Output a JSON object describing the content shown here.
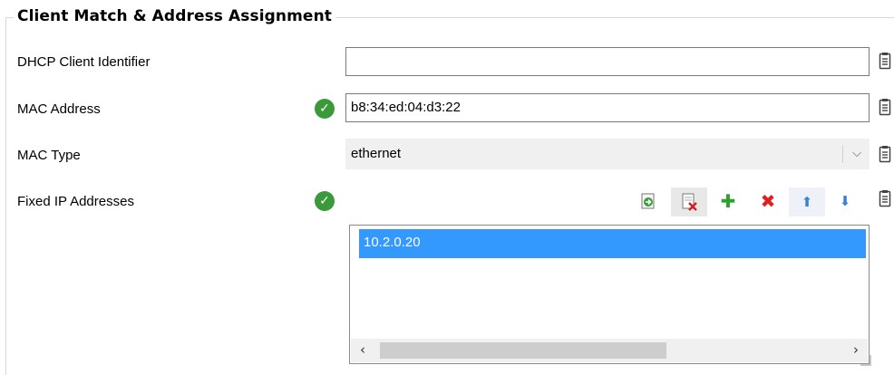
{
  "group": {
    "title": "Client Match & Address Assignment"
  },
  "fields": {
    "dhcp_client_identifier": {
      "label": "DHCP Client Identifier",
      "value": ""
    },
    "mac_address": {
      "label": "MAC Address",
      "value": "b8:34:ed:04:d3:22",
      "valid": true
    },
    "mac_type": {
      "label": "MAC Type",
      "selected": "ethernet"
    },
    "fixed_ip_addresses": {
      "label": "Fixed IP Addresses",
      "valid": true,
      "items": [
        "10.2.0.20"
      ]
    }
  },
  "toolbar": [
    "import-icon",
    "clear-list-icon",
    "add-icon",
    "delete-icon",
    "move-up-icon",
    "move-down-icon"
  ],
  "icons": {
    "valid": "check-circle-icon",
    "clipboard": "clipboard-icon"
  },
  "colors": {
    "check_green": "#3a9a3a",
    "selection_blue": "#3399ff",
    "add_green": "#2e9e2e",
    "delete_red": "#e02020",
    "arrow_blue": "#3b7fd4"
  }
}
